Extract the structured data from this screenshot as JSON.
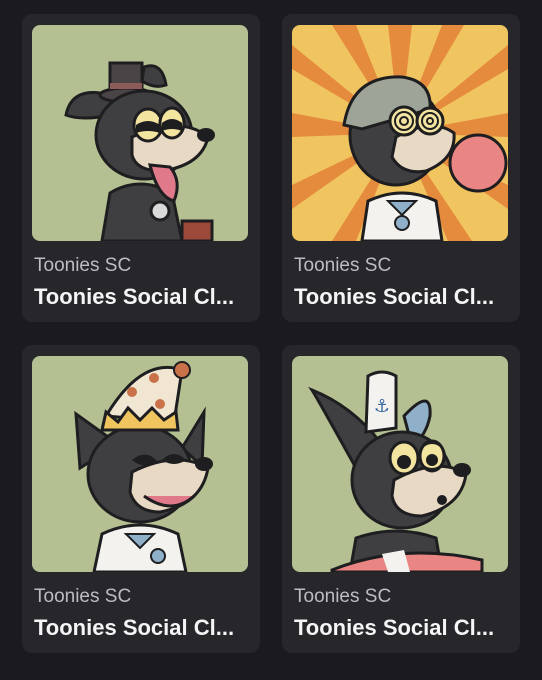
{
  "gallery": {
    "items": [
      {
        "collection": "Toonies SC",
        "name": "Toonies Social Cl...",
        "background": "sage",
        "accessory": "top-hat"
      },
      {
        "collection": "Toonies SC",
        "name": "Toonies Social Cl...",
        "background": "sunburst",
        "accessory": "cap-bubblegum"
      },
      {
        "collection": "Toonies SC",
        "name": "Toonies Social Cl...",
        "background": "sage",
        "accessory": "crown-party-hat"
      },
      {
        "collection": "Toonies SC",
        "name": "Toonies Social Cl...",
        "background": "sage",
        "accessory": "sailor-hat-lifebuoy"
      }
    ]
  },
  "colors": {
    "page_bg": "#1b1b1f",
    "card_bg": "#26262b",
    "sage": "#b4c092",
    "sun": "#f0c560",
    "ray": "#e58b3d"
  }
}
